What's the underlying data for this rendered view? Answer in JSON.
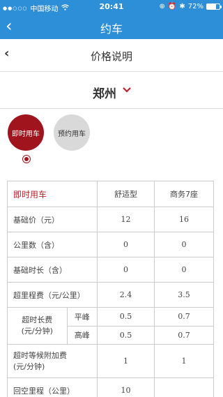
{
  "status": {
    "carrier": "中国移动",
    "time": "20:41",
    "battery": "72%",
    "battery_level": 0.72
  },
  "nav": {
    "back_icon": "‹",
    "title": "约车"
  },
  "sub": {
    "back_icon": "‹",
    "title": "价格说明"
  },
  "city": {
    "name": "郑州",
    "chevron": "⌄"
  },
  "modes": [
    {
      "label": "即时用车",
      "selected": true
    },
    {
      "label": "预约用车",
      "selected": false
    }
  ],
  "table": {
    "header": [
      "即时用车",
      "舒适型",
      "商务7座"
    ],
    "rows": [
      {
        "label": "基础价（元）",
        "a": "12",
        "b": "16"
      },
      {
        "label": "公里数（含）",
        "a": "0",
        "b": "0"
      },
      {
        "label": "基础时长（含）",
        "a": "0",
        "b": "0"
      },
      {
        "label": "超里程费（元/公里）",
        "a": "2.4",
        "b": "3.5"
      }
    ],
    "overtime": {
      "label1": "超时长费",
      "label2": "(元/分钟)",
      "peak_flat": {
        "label": "平峰",
        "a": "0.5",
        "b": "0.7"
      },
      "peak_high": {
        "label": "高峰",
        "a": "0.5",
        "b": "0.7"
      }
    },
    "wait": {
      "label1": "超时等候附加费",
      "label2": "(元/分钟)",
      "a": "1",
      "b": "1"
    },
    "empty": {
      "label": "回空里程（公里）",
      "a": "10",
      "b": ""
    }
  }
}
